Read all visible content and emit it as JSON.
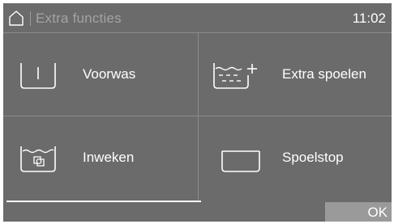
{
  "header": {
    "title": "Extra functies",
    "time": "11:02",
    "home_icon": "home-icon"
  },
  "options": [
    {
      "label": "Voorwas",
      "icon": "prewash-icon"
    },
    {
      "label": "Extra spoelen",
      "icon": "extra-rinse-icon"
    },
    {
      "label": "Inweken",
      "icon": "soak-icon"
    },
    {
      "label": "Spoelstop",
      "icon": "rinse-hold-icon"
    }
  ],
  "footer": {
    "ok_label": "OK"
  },
  "colors": {
    "background": "#6b6b6b",
    "divider": "#8c8c8c",
    "ok_button": "#9a9a9a",
    "text": "#ffffff",
    "header_title": "#a3a3a3"
  }
}
